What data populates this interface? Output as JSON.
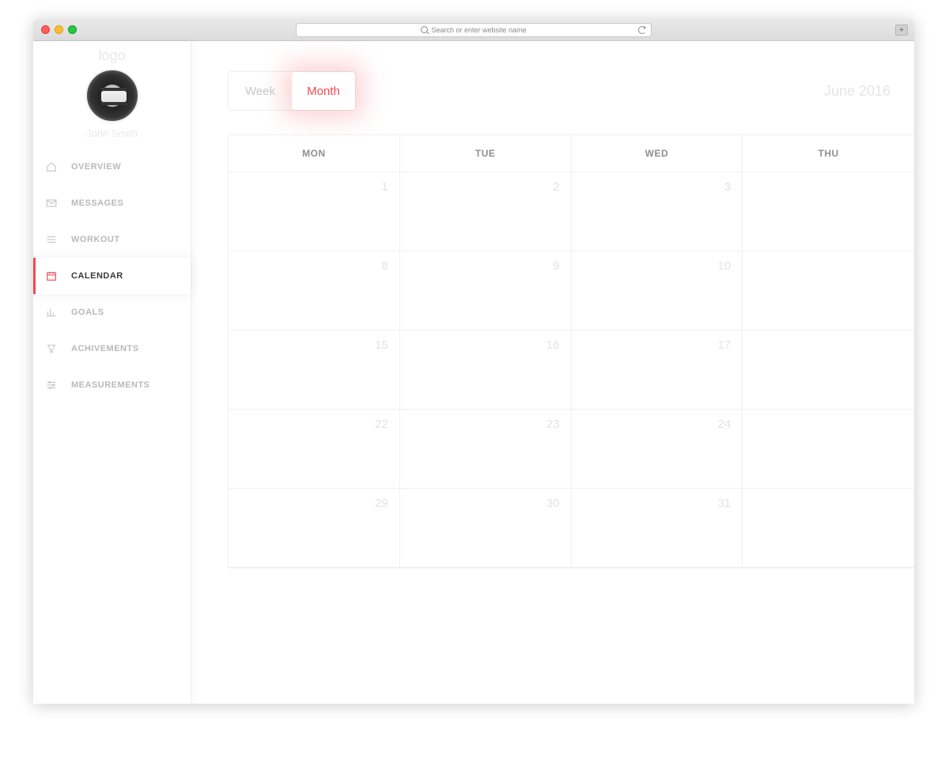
{
  "browser": {
    "address_placeholder": "Search or enter website name"
  },
  "sidebar": {
    "logo": "logo",
    "username": "John Smith",
    "items": [
      {
        "label": "OVERVIEW",
        "icon": "home-icon"
      },
      {
        "label": "MESSAGES",
        "icon": "envelope-icon"
      },
      {
        "label": "WORKOUT",
        "icon": "list-icon"
      },
      {
        "label": "CALENDAR",
        "icon": "calendar-icon"
      },
      {
        "label": "GOALS",
        "icon": "chart-icon"
      },
      {
        "label": "ACHIVEMENTS",
        "icon": "trophy-icon"
      },
      {
        "label": "MEASUREMENTS",
        "icon": "sliders-icon"
      }
    ],
    "active_index": 3
  },
  "toolbar": {
    "week_label": "Week",
    "month_label": "Month",
    "current_period": "June 2016",
    "active_view": "month"
  },
  "calendar": {
    "day_headers": [
      "MON",
      "TUE",
      "WED",
      "THU"
    ],
    "weeks": [
      [
        "1",
        "2",
        "3",
        ""
      ],
      [
        "8",
        "9",
        "10",
        ""
      ],
      [
        "15",
        "16",
        "17",
        ""
      ],
      [
        "22",
        "23",
        "24",
        ""
      ],
      [
        "29",
        "30",
        "31",
        ""
      ]
    ]
  },
  "colors": {
    "accent": "#f44a52"
  }
}
